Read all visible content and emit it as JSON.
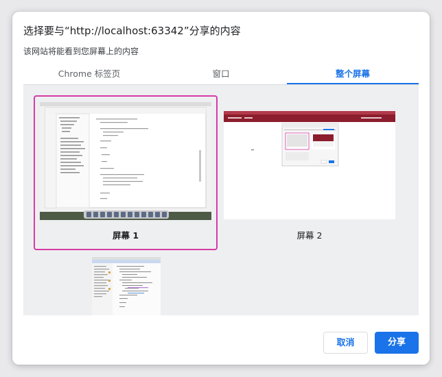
{
  "dialog": {
    "title": "选择要与“http://localhost:63342”分享的内容",
    "subtitle": "该网站将能看到您屏幕上的内容"
  },
  "tabs": [
    {
      "label": "Chrome 标签页",
      "active": false
    },
    {
      "label": "窗口",
      "active": false
    },
    {
      "label": "整个屏幕",
      "active": true
    }
  ],
  "screens": [
    {
      "label": "屏幕 1",
      "selected": true
    },
    {
      "label": "屏幕 2",
      "selected": false
    },
    {
      "label": "",
      "selected": false
    }
  ],
  "buttons": {
    "cancel": "取消",
    "share": "分享"
  },
  "colors": {
    "accent": "#1a73e8",
    "selection": "#d63ba6",
    "screen2_bar": "#8b1d2c"
  }
}
